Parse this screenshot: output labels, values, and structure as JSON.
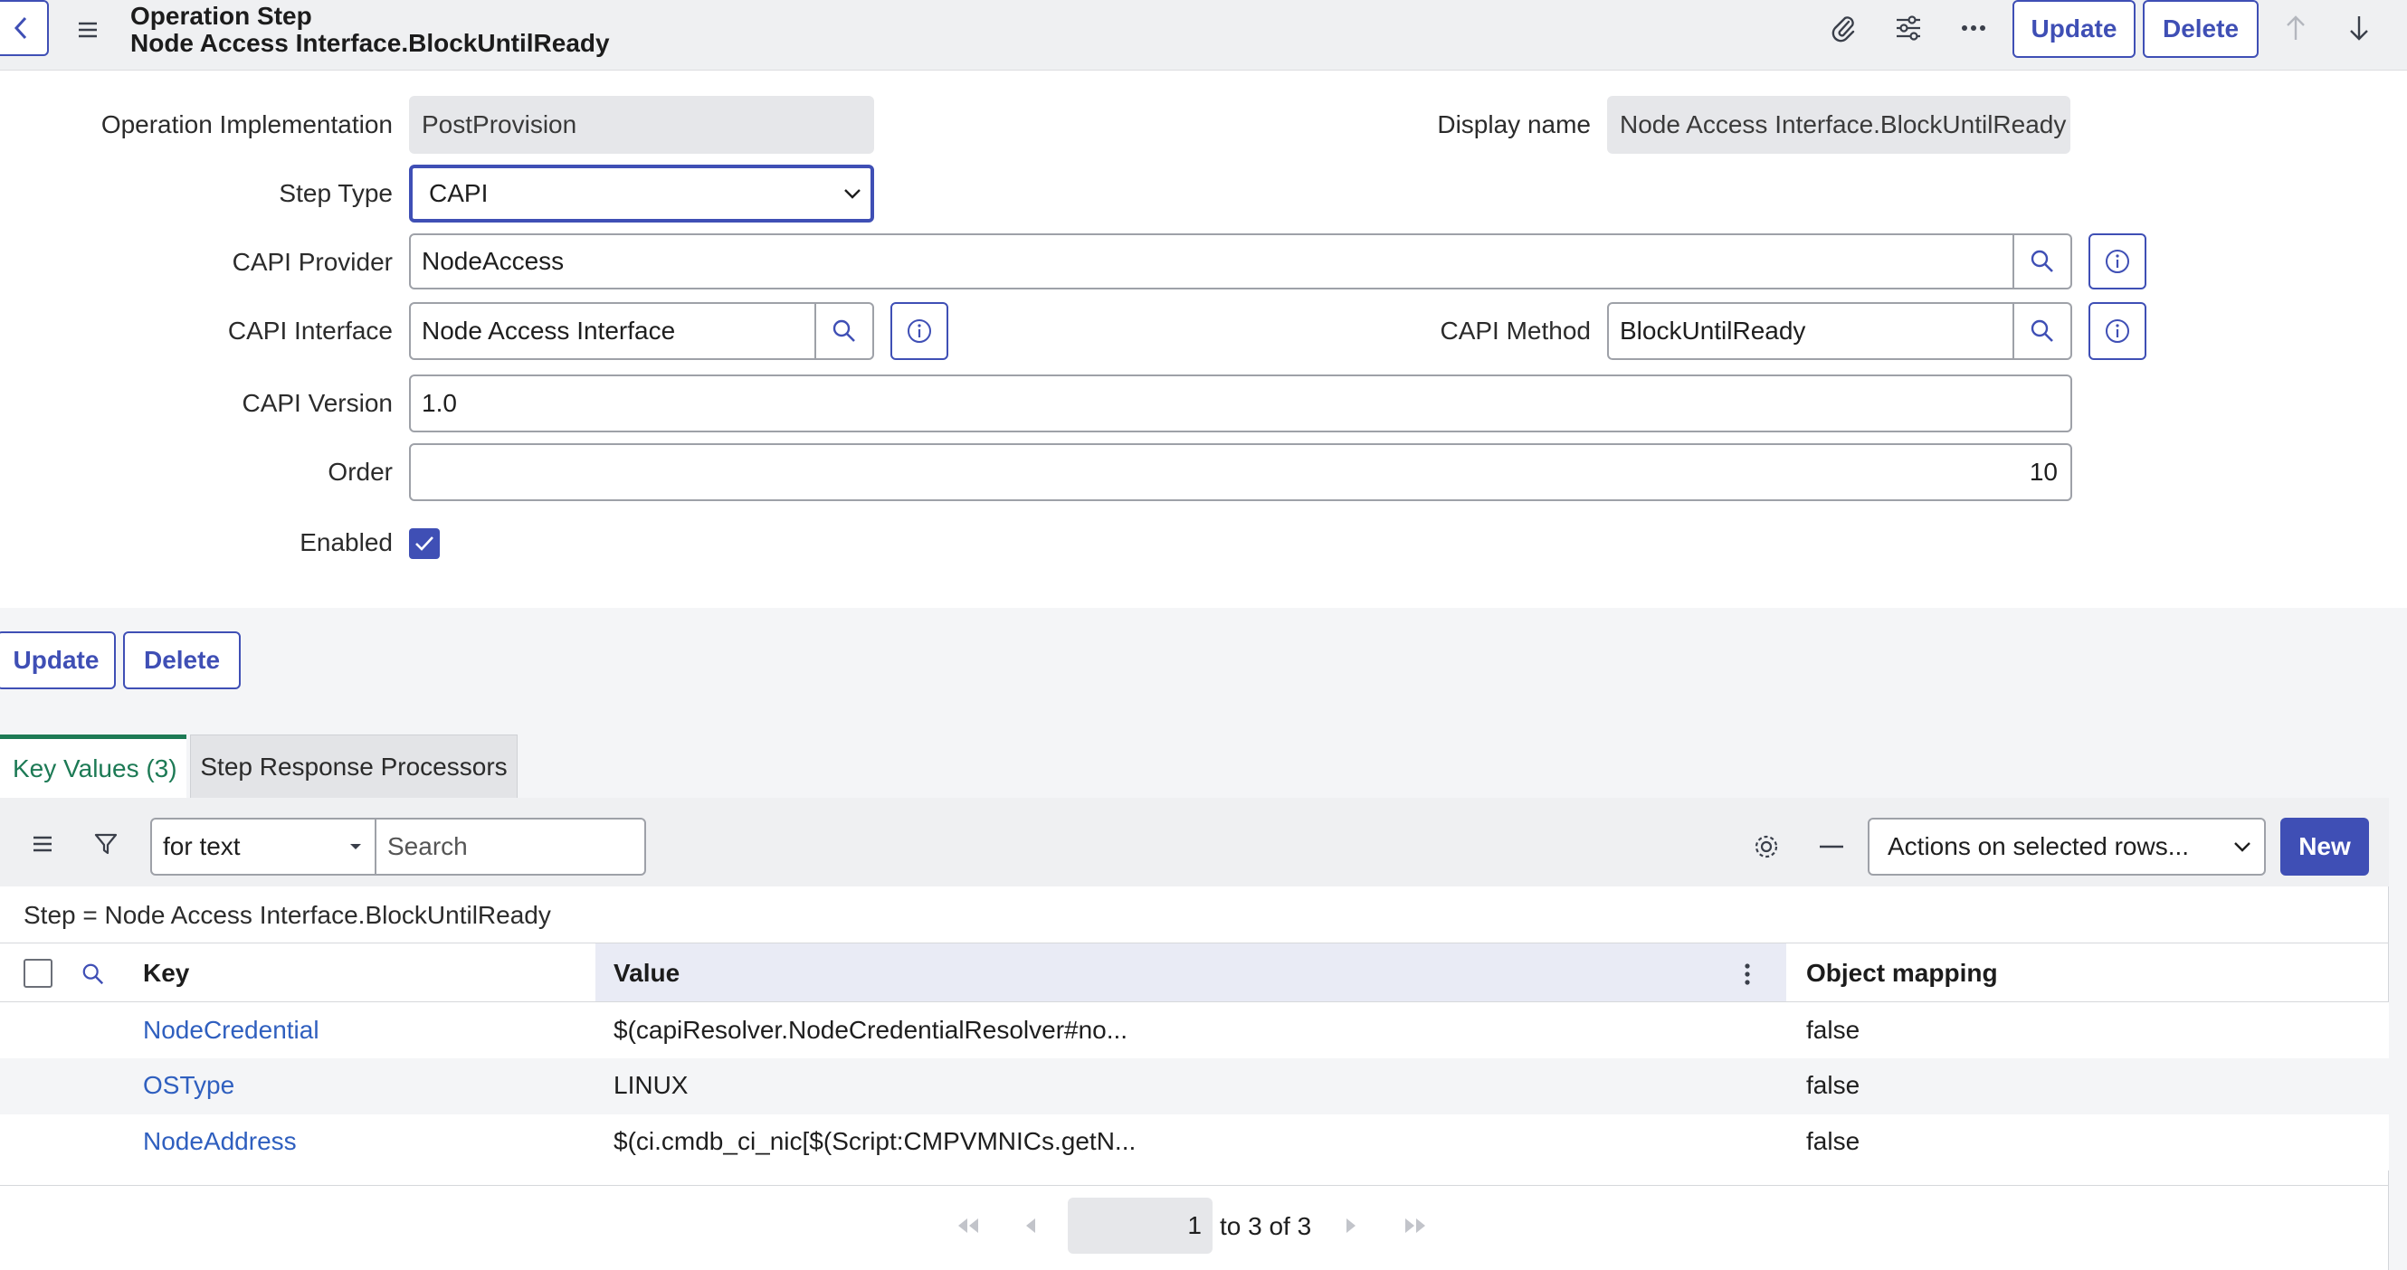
{
  "header": {
    "record_type": "Operation Step",
    "record_name": "Node Access Interface.BlockUntilReady",
    "update_label": "Update",
    "delete_label": "Delete",
    "icons": [
      "chevron-left-icon",
      "hamburger-icon",
      "paperclip-icon",
      "sliders-icon",
      "more-icon",
      "arrow-up-icon",
      "arrow-down-icon"
    ]
  },
  "form": {
    "operation_implementation": {
      "label": "Operation Implementation",
      "value": "PostProvision"
    },
    "display_name": {
      "label": "Display name",
      "value": "Node Access Interface.BlockUntilReady"
    },
    "step_type": {
      "label": "Step Type",
      "value": "CAPI"
    },
    "capi_provider": {
      "label": "CAPI Provider",
      "value": "NodeAccess"
    },
    "capi_interface": {
      "label": "CAPI Interface",
      "value": "Node Access Interface"
    },
    "capi_method": {
      "label": "CAPI Method",
      "value": "BlockUntilReady"
    },
    "capi_version": {
      "label": "CAPI Version",
      "value": "1.0"
    },
    "order": {
      "label": "Order",
      "value": "10"
    },
    "enabled": {
      "label": "Enabled",
      "checked": true
    }
  },
  "form_actions": {
    "update_label": "Update",
    "delete_label": "Delete"
  },
  "tabs": [
    {
      "label": "Key Values (3)",
      "active": true
    },
    {
      "label": "Step Response Processors",
      "active": false
    }
  ],
  "list": {
    "search_type": "for text",
    "search_placeholder": "Search",
    "actions_label": "Actions on selected rows...",
    "new_label": "New",
    "breadcrumb": "Step = Node Access Interface.BlockUntilReady",
    "columns": [
      "Key",
      "Value",
      "Object mapping"
    ],
    "rows": [
      {
        "key": "NodeCredential",
        "value": "$(capiResolver.NodeCredentialResolver#no...",
        "object_mapping": "false"
      },
      {
        "key": "OSType",
        "value": "LINUX",
        "object_mapping": "false"
      },
      {
        "key": "NodeAddress",
        "value": "$(ci.cmdb_ci_nic[$(Script:CMPVMNICs.getN...",
        "object_mapping": "false"
      }
    ],
    "pagination": {
      "page": "1",
      "range_text": "to 3 of 3"
    }
  },
  "colors": {
    "accent": "#3f4fb5",
    "tab_active": "#1d7a55",
    "link": "#2f5fbf",
    "header_bg": "#eff0f2"
  }
}
